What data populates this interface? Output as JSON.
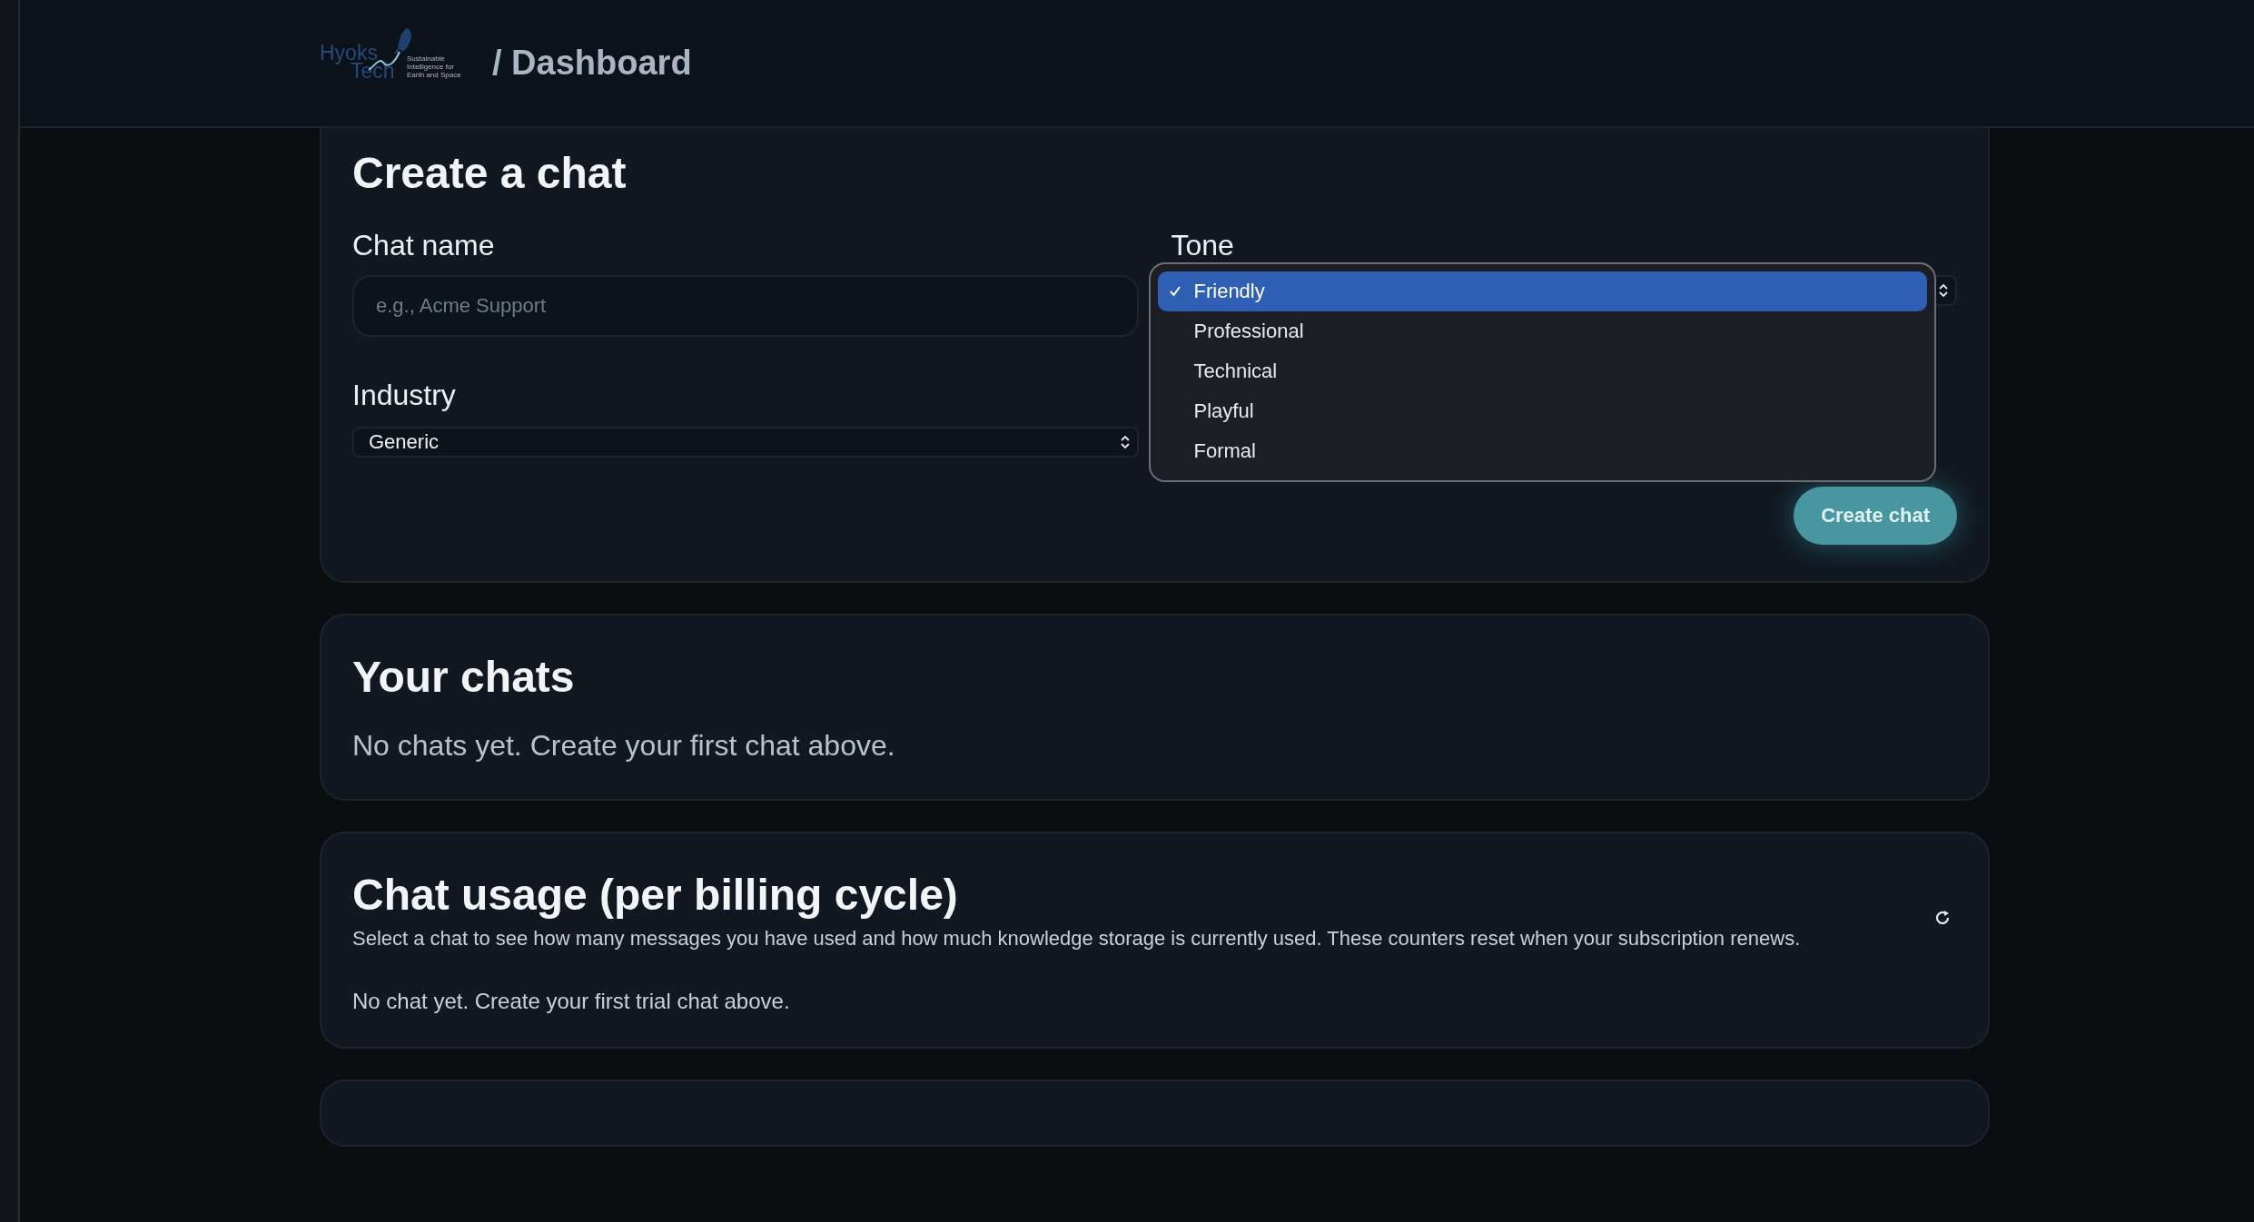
{
  "header": {
    "logo": {
      "word_1": "Hyoks",
      "word_2": "Tech",
      "tagline": "Sustainable Intelligence for Earth and Space"
    },
    "page_title": "/ Dashboard"
  },
  "create_chat": {
    "title": "Create a chat",
    "chat_name": {
      "label": "Chat name",
      "placeholder": "e.g., Acme Support"
    },
    "industry": {
      "label": "Industry",
      "value": "Generic"
    },
    "tone": {
      "label": "Tone",
      "expanded": true,
      "options": [
        {
          "label": "Friendly",
          "selected": true
        },
        {
          "label": "Professional",
          "selected": false
        },
        {
          "label": "Technical",
          "selected": false
        },
        {
          "label": "Playful",
          "selected": false
        },
        {
          "label": "Formal",
          "selected": false
        }
      ]
    },
    "button": "Create chat"
  },
  "your_chats": {
    "title": "Your chats",
    "empty_text": "No chats yet. Create your first chat above."
  },
  "chat_usage": {
    "title": "Chat usage (per billing cycle)",
    "description": "Select a chat to see how many messages you have used and how much knowledge storage is currently used. These counters reset when your subscription renews.",
    "empty_text": "No chat yet. Create your first trial chat above."
  }
}
